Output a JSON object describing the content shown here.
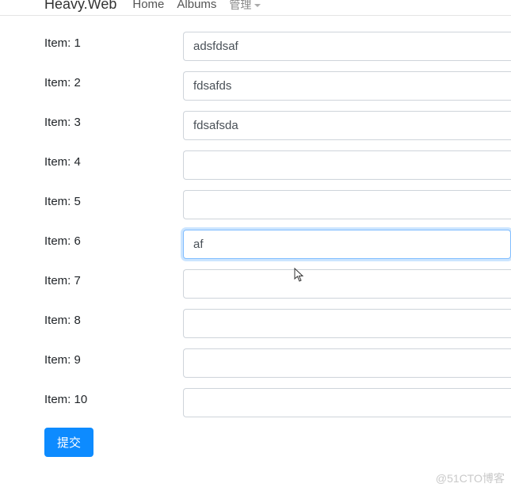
{
  "nav": {
    "brand": "Heavy.Web",
    "home": "Home",
    "albums": "Albums",
    "manage": "管理"
  },
  "form": {
    "items": [
      {
        "label": "Item: 1",
        "value": "adsfdsaf",
        "focused": false
      },
      {
        "label": "Item: 2",
        "value": "fdsafds",
        "focused": false
      },
      {
        "label": "Item: 3",
        "value": "fdsafsda",
        "focused": false
      },
      {
        "label": "Item: 4",
        "value": "",
        "focused": false
      },
      {
        "label": "Item: 5",
        "value": "",
        "focused": false
      },
      {
        "label": "Item: 6",
        "value": "af",
        "focused": true
      },
      {
        "label": "Item: 7",
        "value": "",
        "focused": false
      },
      {
        "label": "Item: 8",
        "value": "",
        "focused": false
      },
      {
        "label": "Item: 9",
        "value": "",
        "focused": false
      },
      {
        "label": "Item: 10",
        "value": "",
        "focused": false
      }
    ],
    "submit_label": "提交"
  },
  "watermark": "@51CTO博客"
}
